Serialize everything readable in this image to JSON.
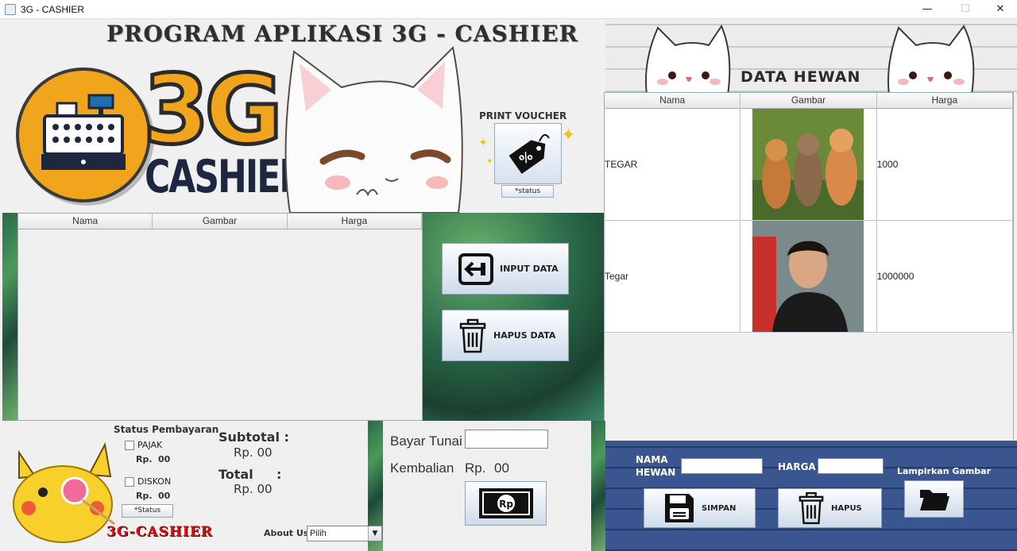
{
  "window": {
    "title": "3G - CASHIER"
  },
  "header": {
    "app_title": "PROGRAM APLIKASI 3G - CASHIER",
    "logo_big": "3G",
    "logo_small": "CASHIER"
  },
  "voucher": {
    "title": "PRINT VOUCHER",
    "status_label": "*status"
  },
  "cart_table": {
    "columns": [
      "Nama",
      "Gambar",
      "Harga"
    ]
  },
  "actions": {
    "input_label": "INPUT DATA",
    "delete_label": "HAPUS DATA"
  },
  "data_hewan": {
    "title": "DATA HEWAN",
    "columns": [
      "Nama",
      "Gambar",
      "Harga"
    ],
    "rows": [
      {
        "nama": "TEGAR",
        "gambar": "cats-photo",
        "harga": "1000"
      },
      {
        "nama": "Tegar",
        "gambar": "person-photo",
        "harga": "1000000"
      }
    ]
  },
  "payment_status": {
    "title": "Status Pembayaran",
    "pajak_label": "PAJAK",
    "pajak_value_prefix": "Rp.",
    "pajak_value": "00",
    "diskon_label": "DISKON",
    "diskon_value_prefix": "Rp.",
    "diskon_value": "00",
    "status_button": "*Status"
  },
  "totals": {
    "subtotal_label": "Subtotal :",
    "subtotal_value": "Rp. 00",
    "total_label": "Total",
    "total_colon": ":",
    "total_value": "Rp. 00"
  },
  "footer": {
    "brand": "3G-CASHIER",
    "about_label": "About Us :",
    "about_selected": "Pilih"
  },
  "payment": {
    "bayar_label": "Bayar Tunai",
    "bayar_value": "",
    "kembalian_label": "Kembalian",
    "kembalian_prefix": "Rp.",
    "kembalian_value": "00",
    "pay_icon_text": "Rp"
  },
  "form": {
    "nama_label_line1": "NAMA",
    "nama_label_line2": "HEWAN",
    "nama_value": "",
    "harga_label": "HARGA",
    "harga_value": "",
    "attach_label": "Lampirkan Gambar",
    "save_label": "SIMPAN",
    "delete_label": "HAPUS"
  },
  "colors": {
    "accent_orange": "#f0a51c",
    "brand_red": "#d8101a",
    "form_blue": "#2d4a80"
  },
  "icons": [
    "window-app-icon",
    "cash-register-icon",
    "discount-tag-icon",
    "input-data-icon",
    "trash-icon",
    "money-icon",
    "floppy-icon",
    "folder-icon"
  ]
}
